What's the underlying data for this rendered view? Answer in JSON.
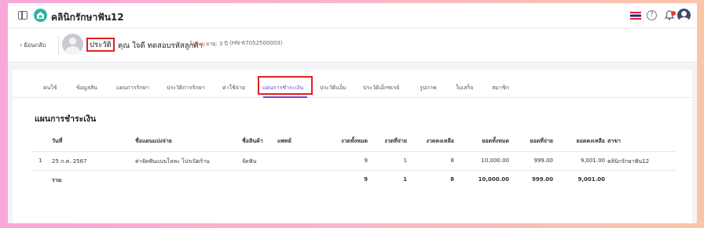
{
  "topbar": {
    "app_title": "คลินิกรักษาฟัน12",
    "icons": [
      "sidebar-toggle-icon",
      "tooth-logo-icon",
      "thai-flag-icon",
      "help-icon",
      "bell-icon",
      "user-avatar-icon"
    ],
    "help_glyph": "?"
  },
  "patient": {
    "back_label": "ย้อนกลับ",
    "history_button": "ประวัติ",
    "name": "คุณ ใจดี ทดสอบรหัสลูกค้า",
    "tag": "ไม่ระบุ",
    "age": "อายุ: 3 ปี",
    "hn": "(HN-67052500003)"
  },
  "tabs": [
    {
      "label": "คนไข้"
    },
    {
      "label": "ข้อมูลสิน"
    },
    {
      "label": "แผนการรักษา"
    },
    {
      "label": "ประวัติการรักษา"
    },
    {
      "label": "ค่าใช้จ่าย"
    },
    {
      "label": "แผนการชำระเงิน",
      "active": true
    },
    {
      "label": "ประวัติแอ็บ"
    },
    {
      "label": "ประวัติเอ็กซเรย์"
    },
    {
      "label": "รูปภาพ"
    },
    {
      "label": "ใบเสร็จ"
    },
    {
      "label": "สมาชิก"
    }
  ],
  "section_title": "แผนการชำระเงิน",
  "table": {
    "headers": [
      "วันที่",
      "ชื่อแผนแบ่งจ่าย",
      "ชื่อสินค้า",
      "แพทย์",
      "งวดทั้งหมด",
      "งวดที่จ่าย",
      "งวดคงเหลือ",
      "ยอดทั้งหมด",
      "ยอดที่จ่าย",
      "ยอดคงเหลือ",
      "สาขา"
    ],
    "rows": [
      {
        "index": "1",
        "date": "25 ก.ค. 2567",
        "plan": "ค่าจัดฟันแบบโลหะ โปรเปิดร้าน",
        "product": "จัดฟัน",
        "doctor": "",
        "total_installments": "9",
        "paid_installments": "1",
        "remaining_installments": "8",
        "total_amount": "10,000.00",
        "paid_amount": "999.00",
        "remaining_amount": "9,001.00",
        "branch": "คลินิกรักษาฟัน12"
      }
    ],
    "summary": {
      "label": "รวม",
      "total_installments": "9",
      "paid_installments": "1",
      "remaining_installments": "8",
      "total_amount": "10,000.00",
      "paid_amount": "999.00",
      "remaining_amount": "9,001.00"
    }
  }
}
